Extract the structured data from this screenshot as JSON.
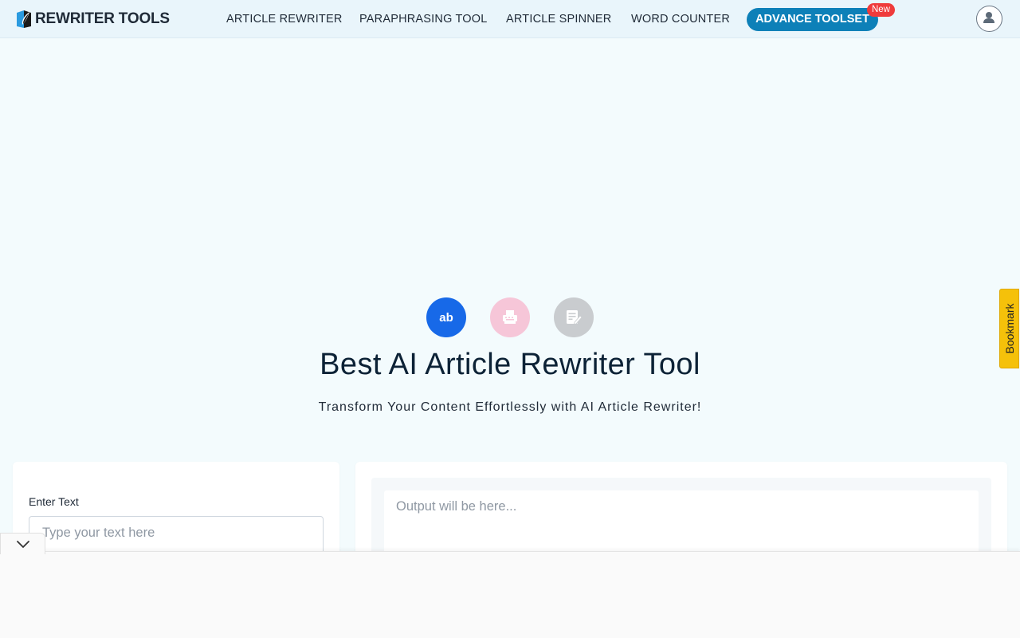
{
  "brand": {
    "name": "REWRITER TOOLS"
  },
  "nav": {
    "items": [
      {
        "label": "ARTICLE REWRITER"
      },
      {
        "label": "PARAPHRASING TOOL"
      },
      {
        "label": "ARTICLE SPINNER"
      },
      {
        "label": "WORD COUNTER"
      }
    ],
    "advance_label": "ADVANCE TOOLSET",
    "new_badge": "New"
  },
  "hero": {
    "icons": [
      {
        "name": "ab-icon",
        "text": "ab",
        "color": "#1769e8"
      },
      {
        "name": "typewriter-icon",
        "color": "#f6c6d8"
      },
      {
        "name": "edit-document-icon",
        "color": "#c9cccf"
      }
    ],
    "title": "Best AI Article Rewriter Tool",
    "subtitle": "Transform Your Content Effortlessly with AI Article Rewriter!"
  },
  "bookmark": {
    "label": "Bookmark"
  },
  "input": {
    "label": "Enter Text",
    "placeholder": "Type your text here"
  },
  "output": {
    "placeholder": "Output will be here..."
  },
  "colors": {
    "accent": "#0d80b8",
    "badge": "#ef3b3b",
    "bookmark": "#f5c10a"
  }
}
